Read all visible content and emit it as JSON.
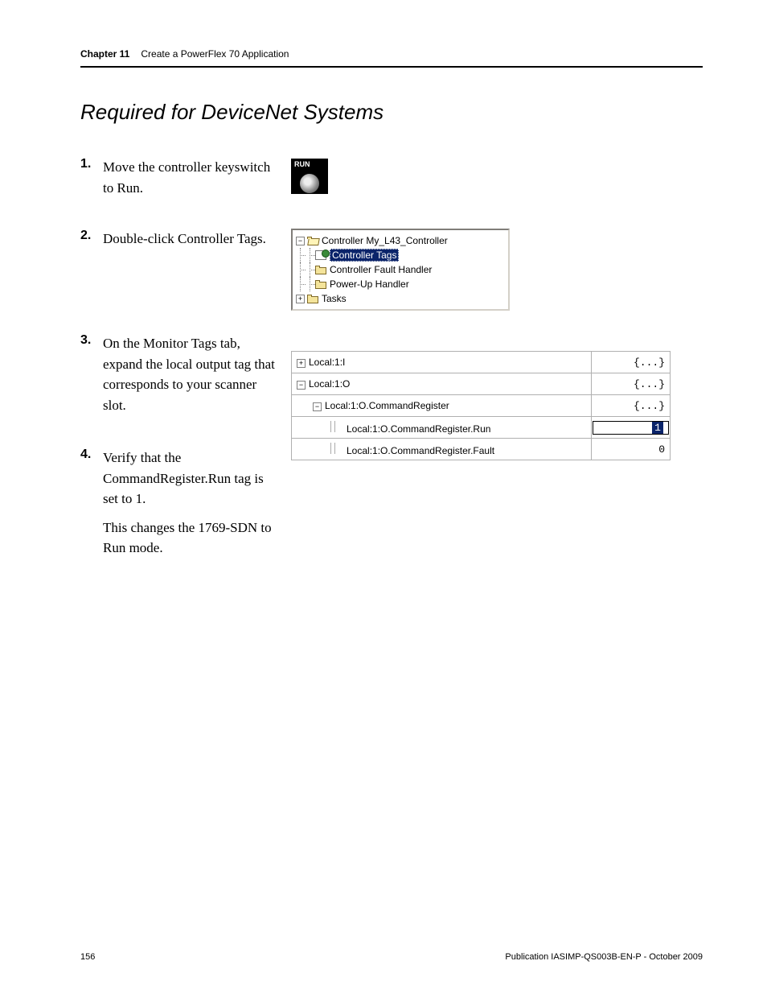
{
  "header": {
    "chapter": "Chapter  11",
    "title": "Create a PowerFlex 70 Application"
  },
  "section_title": "Required for DeviceNet Systems",
  "steps": [
    {
      "num": "1.",
      "text": "Move the controller keyswitch to Run."
    },
    {
      "num": "2.",
      "text": "Double-click Controller Tags."
    },
    {
      "num": "3.",
      "text": "On the Monitor Tags tab, expand the local output tag that corresponds to your scanner slot."
    },
    {
      "num": "4.",
      "text1": "Verify that the CommandRegister.Run tag is set to 1.",
      "text2": "This changes the 1769-SDN to Run mode."
    }
  ],
  "tree": {
    "root": "Controller My_L43_Controller",
    "items": [
      "Controller Tags",
      "Controller Fault Handler",
      "Power-Up Handler"
    ],
    "tasks": "Tasks"
  },
  "tags_table": {
    "rows": [
      {
        "expand": "+",
        "indent": 0,
        "name": "Local:1:I",
        "value": "{...}"
      },
      {
        "expand": "−",
        "indent": 0,
        "name": "Local:1:O",
        "value": "{...}"
      },
      {
        "expand": "−",
        "indent": 1,
        "name": "Local:1:O.CommandRegister",
        "value": "{...}"
      },
      {
        "expand": "",
        "indent": 2,
        "name": "Local:1:O.CommandRegister.Run",
        "value": "1",
        "highlight": true
      },
      {
        "expand": "",
        "indent": 2,
        "name": "Local:1:O.CommandRegister.Fault",
        "value": "0"
      }
    ]
  },
  "footer": {
    "page": "156",
    "pub": "Publication IASIMP-QS003B-EN-P - October 2009"
  }
}
